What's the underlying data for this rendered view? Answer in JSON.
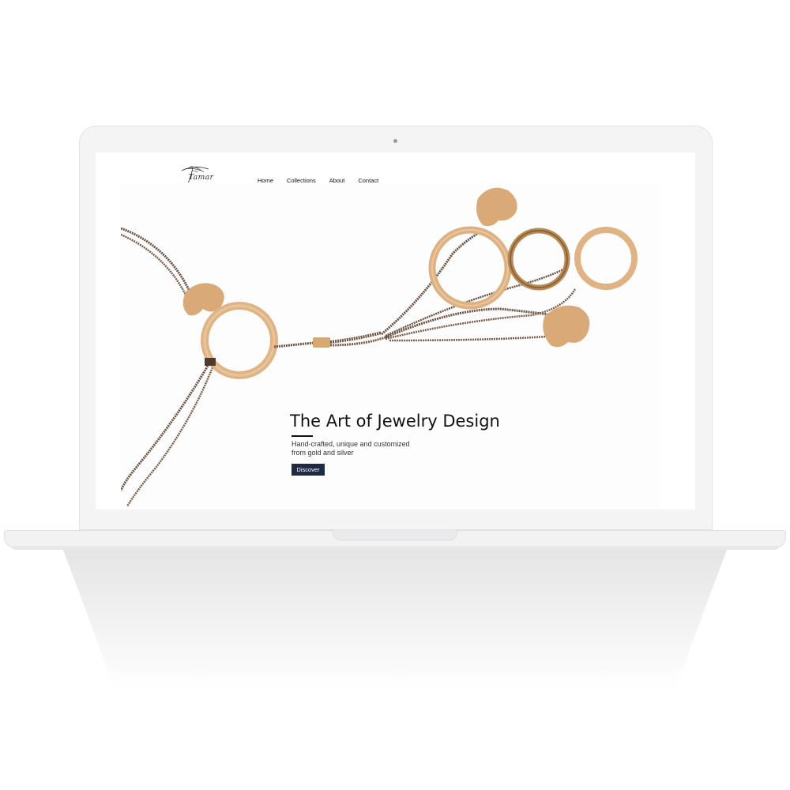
{
  "site": {
    "brand": "Tamar",
    "nav": [
      "Home",
      "Collections",
      "About",
      "Contact"
    ]
  },
  "hero": {
    "title": "The Art of Jewelry Design",
    "subtitle_line1": "Hand-crafted, unique and customized",
    "subtitle_line2": "from gold and silver",
    "cta": "Discover"
  },
  "colors": {
    "cta_background": "#1f2a44",
    "gold": "#d9aa78",
    "bead_chain": "#6b5242",
    "laptop_frame": "#f4f4f5"
  },
  "icons": {
    "logo": "palm-tree-logo-icon"
  }
}
